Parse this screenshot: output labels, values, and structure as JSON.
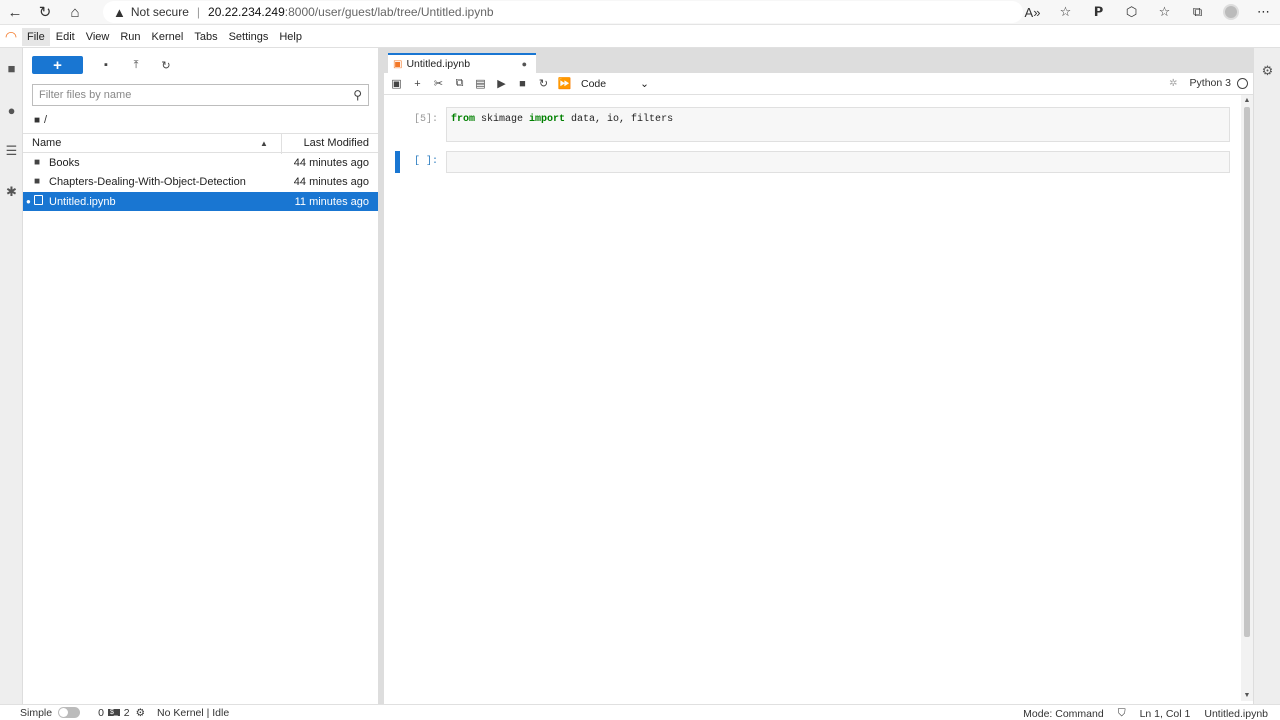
{
  "browser": {
    "security": "Not secure",
    "url_host": "20.22.234.249",
    "url_path": ":8000/user/guest/lab/tree/Untitled.ipynb"
  },
  "menu": [
    "File",
    "Edit",
    "View",
    "Run",
    "Kernel",
    "Tabs",
    "Settings",
    "Help"
  ],
  "filebrowser": {
    "new_label": "+",
    "filter_placeholder": "Filter files by name",
    "breadcrumb": "/",
    "col_name": "Name",
    "col_modified": "Last Modified",
    "rows": [
      {
        "name": "Books",
        "modified": "44 minutes ago",
        "type": "folder"
      },
      {
        "name": "Chapters-Dealing-With-Object-Detection",
        "modified": "44 minutes ago",
        "type": "folder"
      },
      {
        "name": "Untitled.ipynb",
        "modified": "11 minutes ago",
        "type": "notebook"
      }
    ]
  },
  "notebook": {
    "tab_title": "Untitled.ipynb",
    "cell_type": "Code",
    "kernel_name": "Python 3",
    "cells": [
      {
        "prompt": "[5]:",
        "code_from": "from",
        "code_mod": " skimage ",
        "code_import": "import",
        "code_rest": " data, io, filters"
      },
      {
        "prompt": "[ ]:",
        "code": ""
      }
    ]
  },
  "status": {
    "mode_label": "Simple",
    "count_a": "0",
    "count_b": "2",
    "kernel_status": "No Kernel | Idle",
    "mode": "Mode: Command",
    "position": "Ln 1, Col 1",
    "filename": "Untitled.ipynb"
  },
  "colors": {
    "accent": "#1976d2",
    "jupyter_orange": "#f37726"
  }
}
